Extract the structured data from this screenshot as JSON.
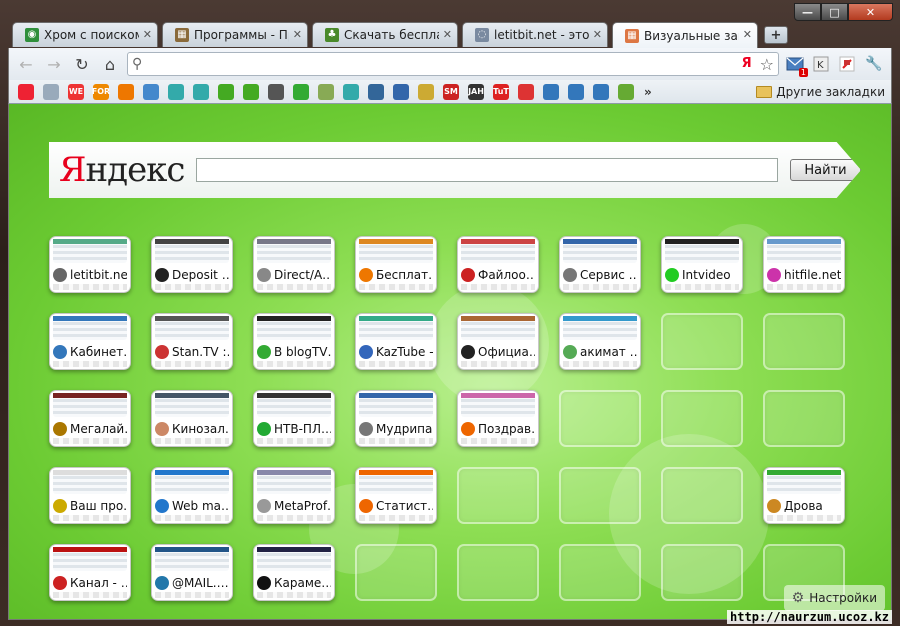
{
  "window": {
    "min": "—",
    "max": "□",
    "close": "✕"
  },
  "tabs": [
    {
      "label": "Хром с поиском Я",
      "icon": "chrome-icon",
      "color": "#2f8f3b",
      "glyph": "◉"
    },
    {
      "label": "Программы - Про",
      "icon": "programs-icon",
      "color": "#8a6a3a",
      "glyph": "▦"
    },
    {
      "label": "Скачать бесплатн",
      "icon": "tree-icon",
      "color": "#4a8a2a",
      "glyph": "♣"
    },
    {
      "label": "letitbit.net - это со",
      "icon": "loading-icon",
      "color": "#7a8aa0",
      "glyph": "◌"
    },
    {
      "label": "Визуальные закла",
      "icon": "grid-icon",
      "color": "#d74",
      "glyph": "▦",
      "active": true
    }
  ],
  "toolbar": {
    "back": "←",
    "forward": "→",
    "reload": "↻",
    "home": "⌂",
    "search_glyph": "⚲",
    "star": "☆",
    "mail_badge": "1",
    "wrench": "🔧"
  },
  "address": {
    "value": "",
    "ya_badge": "Я"
  },
  "bookmarks": [
    {
      "icon": "doc-icon",
      "color": "#e23"
    },
    {
      "icon": "pixel-icon",
      "color": "#9ab"
    },
    {
      "icon": "we-icon",
      "color": "#e33",
      "text": "WE"
    },
    {
      "icon": "for-icon",
      "color": "#e80",
      "text": "FOR"
    },
    {
      "icon": "shield-icon",
      "color": "#e70"
    },
    {
      "icon": "drop-icon",
      "color": "#48c"
    },
    {
      "icon": "book-icon",
      "color": "#3aa"
    },
    {
      "icon": "book2-icon",
      "color": "#3aa"
    },
    {
      "icon": "tree-icon",
      "color": "#4a2"
    },
    {
      "icon": "tree2-icon",
      "color": "#4a2"
    },
    {
      "icon": "globe-icon",
      "color": "#555"
    },
    {
      "icon": "money-icon",
      "color": "#3a3"
    },
    {
      "icon": "flask-icon",
      "color": "#8a5"
    },
    {
      "icon": "book3-icon",
      "color": "#3aa"
    },
    {
      "icon": "monitor-icon",
      "color": "#369"
    },
    {
      "icon": "bird-icon",
      "color": "#36a"
    },
    {
      "icon": "gear-icon",
      "color": "#ca3"
    },
    {
      "icon": "sm-icon",
      "color": "#c22",
      "text": "SM"
    },
    {
      "icon": "jah-icon",
      "color": "#333",
      "text": "JAH"
    },
    {
      "icon": "tut-icon",
      "color": "#d22",
      "text": "TuT"
    },
    {
      "icon": "lifebuoy-icon",
      "color": "#d33"
    },
    {
      "icon": "globe2-icon",
      "color": "#37b"
    },
    {
      "icon": "globe3-icon",
      "color": "#37b"
    },
    {
      "icon": "globe4-icon",
      "color": "#37b"
    },
    {
      "icon": "puzzle-icon",
      "color": "#6a3"
    }
  ],
  "bookmarks_more": "»",
  "other_bookmarks": "Другие закладки",
  "yandex": {
    "logo_first": "Я",
    "logo_rest": "ндекс",
    "button": "Найти"
  },
  "tiles": [
    [
      {
        "label": "letitbit.ne…",
        "fav": "#666",
        "strip": "#5a8"
      },
      {
        "label": "Deposit …",
        "fav": "#222",
        "strip": "#444"
      },
      {
        "label": "Direct/A…",
        "fav": "#888",
        "strip": "#778"
      },
      {
        "label": "Бесплат…",
        "fav": "#e70",
        "strip": "#d82"
      },
      {
        "label": "Файлоо…",
        "fav": "#c22",
        "strip": "#c44"
      },
      {
        "label": "Сервис …",
        "fav": "#777",
        "strip": "#36a"
      },
      {
        "label": "Intvideo",
        "fav": "#2c2",
        "strip": "#222"
      },
      {
        "label": "hitfile.net…",
        "fav": "#c3a",
        "strip": "#69c"
      }
    ],
    [
      {
        "label": "Кабинет…",
        "fav": "#37b",
        "strip": "#37b"
      },
      {
        "label": "Stan.TV :…",
        "fav": "#c33",
        "strip": "#555"
      },
      {
        "label": "В blogTV…",
        "fav": "#3a3",
        "strip": "#222"
      },
      {
        "label": "KazTube -…",
        "fav": "#36b",
        "strip": "#3a8"
      },
      {
        "label": "Официа…",
        "fav": "#222",
        "strip": "#a63"
      },
      {
        "label": "акимат …",
        "fav": "#5a5",
        "strip": "#39c"
      },
      null,
      null
    ],
    [
      {
        "label": "Мегалай…",
        "fav": "#a70",
        "strip": "#722"
      },
      {
        "label": "Кинозал…",
        "fav": "#c86",
        "strip": "#456"
      },
      {
        "label": "НТВ-ПЛ…",
        "fav": "#2a3",
        "strip": "#333"
      },
      {
        "label": "Мудрипа…",
        "fav": "#777",
        "strip": "#36a"
      },
      {
        "label": "Поздрав…",
        "fav": "#e60",
        "strip": "#c6a"
      },
      null,
      null,
      null
    ],
    [
      {
        "label": "Ваш про…",
        "fav": "#ca0",
        "strip": "#ddd"
      },
      {
        "label": "Web ma…",
        "fav": "#27c",
        "strip": "#27c"
      },
      {
        "label": "MetaProf…",
        "fav": "#999",
        "strip": "#88a"
      },
      {
        "label": "Статист…",
        "fav": "#e60",
        "strip": "#e60"
      },
      null,
      null,
      null,
      {
        "label": "Дрова",
        "fav": "#c82",
        "strip": "#3a3"
      }
    ],
    [
      {
        "label": "Канал - …",
        "fav": "#c22",
        "strip": "#b11"
      },
      {
        "label": "@MAIL.…",
        "fav": "#27a",
        "strip": "#258"
      },
      {
        "label": "Карамe…",
        "fav": "#111",
        "strip": "#224"
      },
      null,
      null,
      null,
      null,
      null
    ]
  ],
  "settings_label": "Настройки",
  "watermark": "http://naurzum.ucoz.kz"
}
